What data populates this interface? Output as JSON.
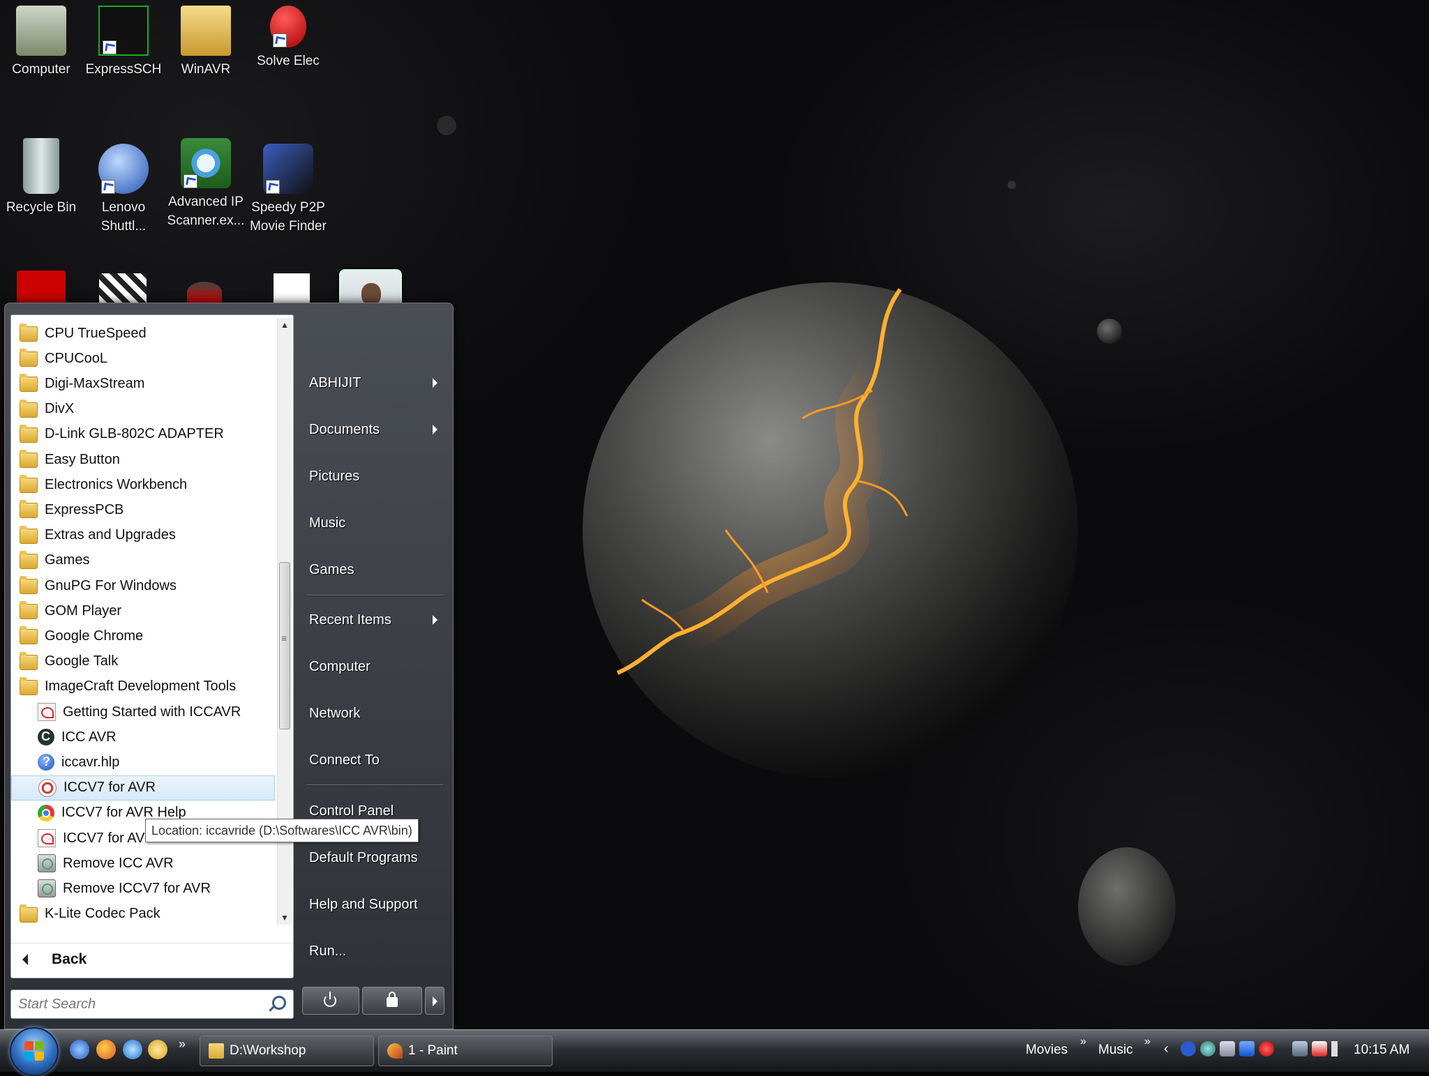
{
  "desktop": {
    "icons": [
      {
        "label": "Computer",
        "color": "#7fae5a"
      },
      {
        "label": "ExpressSCH",
        "color": "#1fa81f"
      },
      {
        "label": "WinAVR",
        "color": "#e5c34e"
      },
      {
        "label": "Solve Elec",
        "color": "#d22"
      },
      {
        "label": "Recycle Bin",
        "color": "#9aa"
      },
      {
        "label": "Lenovo Shuttl...",
        "color": "#3a6fd0"
      },
      {
        "label": "Advanced IP Scanner.ex...",
        "color": "#4aa0e0"
      },
      {
        "label": "Speedy P2P Movie Finder",
        "color": "#3b5dbd"
      }
    ]
  },
  "start_menu": {
    "programs": [
      {
        "label": "CPU TrueSpeed",
        "icon": "folder-icon",
        "child": false
      },
      {
        "label": "CPUCooL",
        "icon": "folder-icon",
        "child": false
      },
      {
        "label": "Digi-MaxStream",
        "icon": "folder-icon",
        "child": false
      },
      {
        "label": "DivX",
        "icon": "folder-icon",
        "child": false
      },
      {
        "label": "D-Link GLB-802C ADAPTER",
        "icon": "folder-icon",
        "child": false
      },
      {
        "label": "Easy Button",
        "icon": "folder-icon",
        "child": false
      },
      {
        "label": "Electronics Workbench",
        "icon": "folder-icon",
        "child": false
      },
      {
        "label": "ExpressPCB",
        "icon": "folder-icon",
        "child": false
      },
      {
        "label": "Extras and Upgrades",
        "icon": "folder-icon",
        "child": false
      },
      {
        "label": "Games",
        "icon": "folder-icon",
        "child": false
      },
      {
        "label": "GnuPG For Windows",
        "icon": "folder-icon",
        "child": false
      },
      {
        "label": "GOM Player",
        "icon": "folder-icon",
        "child": false
      },
      {
        "label": "Google Chrome",
        "icon": "folder-icon",
        "child": false
      },
      {
        "label": "Google Talk",
        "icon": "folder-icon",
        "child": false
      },
      {
        "label": "ImageCraft Development Tools",
        "icon": "folder-icon",
        "child": false
      },
      {
        "label": "Getting Started with ICCAVR",
        "icon": "pdf-icon",
        "child": true
      },
      {
        "label": "ICC AVR",
        "icon": "iccavr-icon",
        "child": true
      },
      {
        "label": "iccavr.hlp",
        "icon": "help-icon",
        "child": true
      },
      {
        "label": "ICCV7 for AVR",
        "icon": "iccv7-icon",
        "child": true,
        "highlighted": true
      },
      {
        "label": "ICCV7 for AVR Help",
        "icon": "chrome-icon",
        "child": true
      },
      {
        "label": "ICCV7 for AVR",
        "icon": "pdf-icon",
        "child": true
      },
      {
        "label": "Remove ICC AVR",
        "icon": "remove-icon",
        "child": true
      },
      {
        "label": "Remove ICCV7 for AVR",
        "icon": "remove-icon",
        "child": true
      },
      {
        "label": "K-Lite Codec Pack",
        "icon": "folder-icon",
        "child": false
      }
    ],
    "back_label": "Back",
    "search_placeholder": "Start Search",
    "tooltip": "Location: iccavride (D:\\Softwares\\ICC AVR\\bin)",
    "right_links": [
      {
        "label": "ABHIJIT",
        "arrow": true
      },
      {
        "label": "Documents",
        "arrow": true
      },
      {
        "label": "Pictures",
        "arrow": false
      },
      {
        "label": "Music",
        "arrow": false
      },
      {
        "label": "Games",
        "arrow": false
      },
      {
        "label": "Recent Items",
        "arrow": true
      },
      {
        "label": "Computer",
        "arrow": false
      },
      {
        "label": "Network",
        "arrow": false
      },
      {
        "label": "Connect To",
        "arrow": false
      },
      {
        "label": "Control Panel",
        "arrow": false
      },
      {
        "label": "Default Programs",
        "arrow": false
      },
      {
        "label": "Help and Support",
        "arrow": false
      },
      {
        "label": "Run...",
        "arrow": false
      }
    ]
  },
  "taskbar": {
    "buttons": [
      {
        "label": "D:\\Workshop",
        "icon": "folder-icon"
      },
      {
        "label": "1 - Paint",
        "icon": "paint-icon"
      }
    ],
    "toolbars": [
      "Movies",
      "Music"
    ],
    "clock": "10:15 AM"
  }
}
